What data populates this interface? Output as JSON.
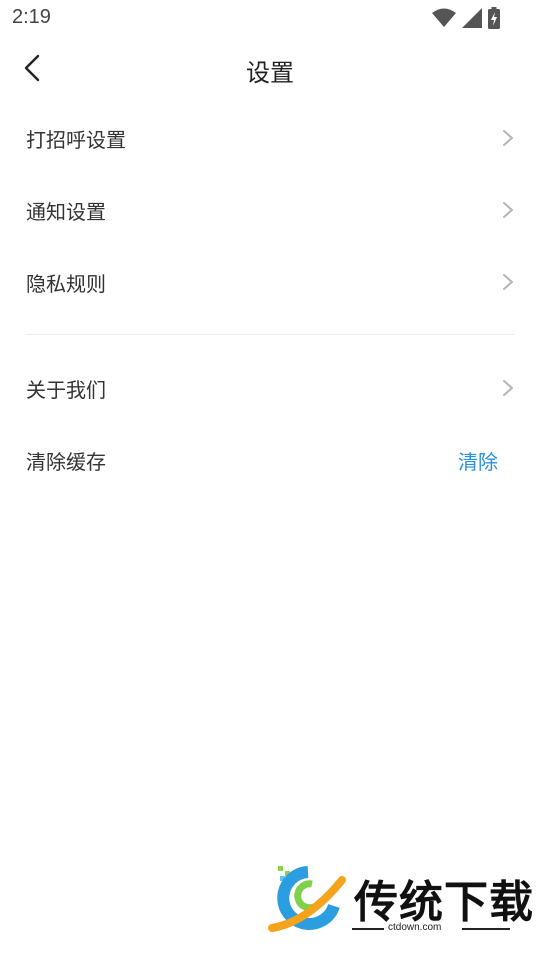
{
  "status_bar": {
    "time": "2:19",
    "icons": [
      "wifi-icon",
      "cell-signal-icon",
      "battery-charging-icon"
    ]
  },
  "header": {
    "title": "设置",
    "back_icon": "chevron-left-icon"
  },
  "settings": {
    "group1": [
      {
        "label": "打招呼设置",
        "icon": "chevron-right-icon"
      },
      {
        "label": "通知设置",
        "icon": "chevron-right-icon"
      },
      {
        "label": "隐私规则",
        "icon": "chevron-right-icon"
      }
    ],
    "about": {
      "label": "关于我们",
      "icon": "chevron-right-icon"
    },
    "cache": {
      "label": "清除缓存",
      "action_label": "清除"
    }
  },
  "colors": {
    "accent": "#2b8fe0",
    "text": "#333333",
    "chevron": "#b5b5b5",
    "divider": "#ededed"
  },
  "watermark": {
    "name": "传统下载",
    "url": "ctdown.com"
  }
}
